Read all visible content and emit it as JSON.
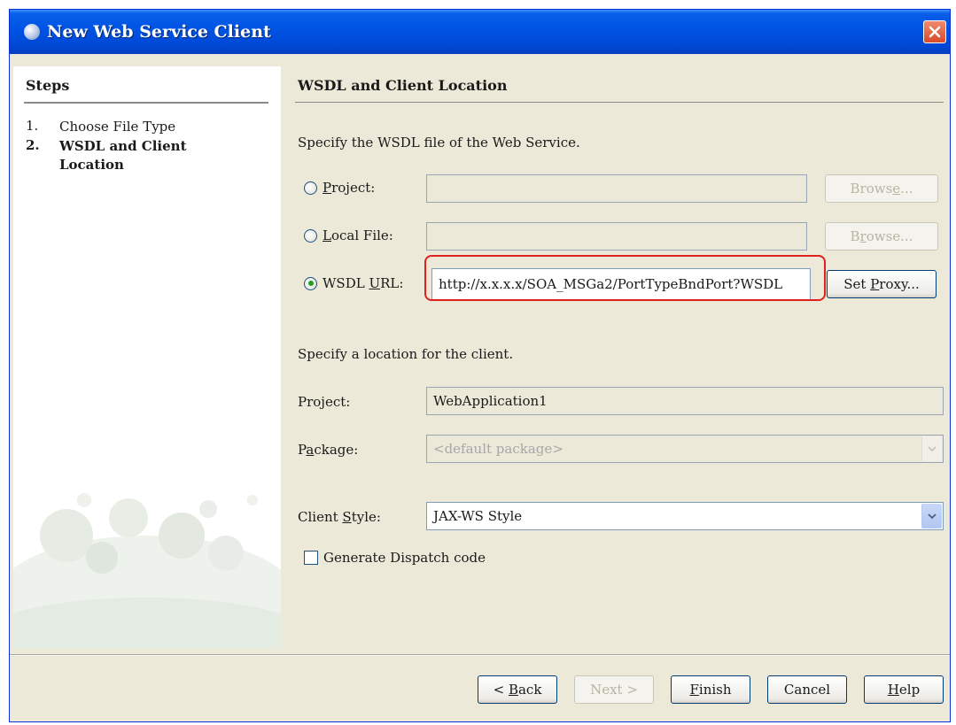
{
  "window": {
    "title": "New Web Service Client"
  },
  "steps": {
    "heading": "Steps",
    "items": [
      {
        "num": "1.",
        "label": "Choose File Type",
        "current": false
      },
      {
        "num": "2.",
        "label": "WSDL and Client Location",
        "current": true
      }
    ]
  },
  "main": {
    "heading": "WSDL and Client Location",
    "wsdl_instruction": "Specify the WSDL file of the Web Service.",
    "project_radio_label": "Project:",
    "project_value": "",
    "local_file_radio_label": "Local File:",
    "local_file_value": "",
    "wsdl_url_radio_label": "WSDL URL:",
    "wsdl_url_value": "http://x.x.x.x/SOA_MSGa2/PortTypeBndPort?WSDL",
    "browse_label": "Browse...",
    "set_proxy_label": "Set Proxy...",
    "location_instruction": "Specify a location for the client.",
    "project_label": "Project:",
    "project_name": "WebApplication1",
    "package_label": "Package:",
    "package_value": "<default package>",
    "client_style_label": "Client Style:",
    "client_style_value": "JAX-WS Style",
    "dispatch_label": "Generate Dispatch code",
    "dispatch_checked": false,
    "selected_source": "WSDL URL"
  },
  "footer": {
    "back": "< Back",
    "next": "Next >",
    "finish": "Finish",
    "cancel": "Cancel",
    "help": "Help"
  },
  "colors": {
    "titlebar": "#0055e5",
    "highlight": "#e0201c",
    "dialog_bg": "#ece9d8"
  }
}
